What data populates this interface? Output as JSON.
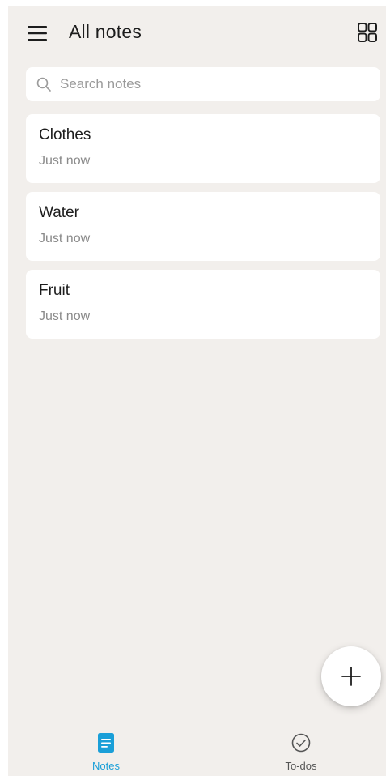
{
  "header": {
    "title": "All notes",
    "menu_icon": "hamburger-menu-icon",
    "view_icon": "grid-view-icon"
  },
  "search": {
    "placeholder": "Search notes",
    "icon": "search-icon"
  },
  "notes": [
    {
      "title": "Clothes",
      "time": "Just now"
    },
    {
      "title": "Water",
      "time": "Just now"
    },
    {
      "title": "Fruit",
      "time": "Just now"
    }
  ],
  "fab": {
    "icon": "plus-icon"
  },
  "bottom_nav": {
    "items": [
      {
        "label": "Notes",
        "icon": "note-icon",
        "active": true
      },
      {
        "label": "To-dos",
        "icon": "checkmark-circle-icon",
        "active": false
      }
    ]
  },
  "colors": {
    "background": "#f2efec",
    "card": "#ffffff",
    "accent": "#1a9fd8",
    "text_primary": "#1d1d1d",
    "text_secondary": "#8a8a8a"
  }
}
